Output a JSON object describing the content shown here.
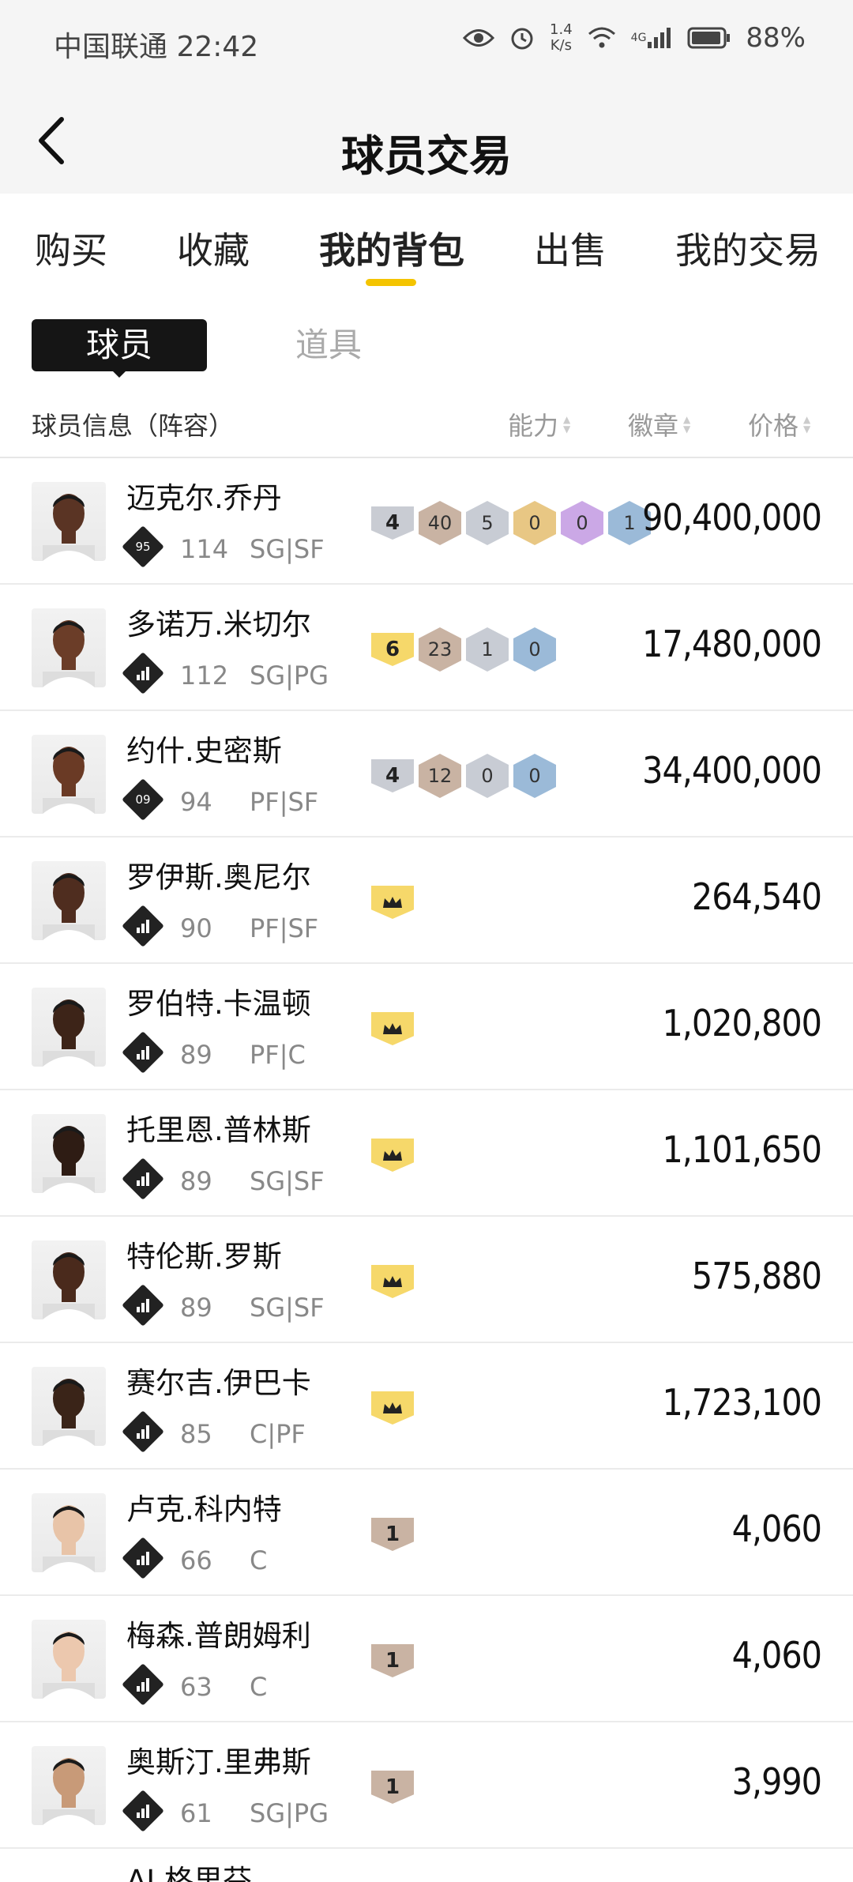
{
  "status_bar": {
    "carrier": "中国联通",
    "time": "22:42",
    "speed_value": "1.4",
    "speed_unit": "K/s",
    "network": "4G",
    "battery": "88%"
  },
  "header": {
    "title": "球员交易"
  },
  "tabs": [
    {
      "label": "购买"
    },
    {
      "label": "收藏"
    },
    {
      "label": "我的背包",
      "active": true
    },
    {
      "label": "出售"
    },
    {
      "label": "我的交易"
    }
  ],
  "subtabs": [
    {
      "label": "球员",
      "active": true
    },
    {
      "label": "道具"
    }
  ],
  "columns": {
    "info": "球员信息（阵容）",
    "ability": "能力",
    "badge": "徽章",
    "price": "价格"
  },
  "colors": {
    "accent": "#f4c400",
    "crown": "#f6d86a",
    "dark": "#151515"
  },
  "players": [
    {
      "name": "迈克尔.乔丹",
      "rating_icon": "95",
      "ovr": "114",
      "pos": "SG|SF",
      "badges": [
        {
          "kind": "shield",
          "value": "4",
          "color": "#c9ccd3"
        },
        {
          "kind": "hex",
          "value": "40",
          "color": "#c9b3a3"
        },
        {
          "kind": "hex",
          "value": "5",
          "color": "#c8ccd4"
        },
        {
          "kind": "hex",
          "value": "0",
          "color": "#e8c784"
        },
        {
          "kind": "hex",
          "value": "0",
          "color": "#cba8e6"
        },
        {
          "kind": "hex",
          "value": "1",
          "color": "#9bbad8"
        }
      ],
      "price": "90,400,000"
    },
    {
      "name": "多诺万.米切尔",
      "rating_icon": "bars",
      "ovr": "112",
      "pos": "SG|PG",
      "badges": [
        {
          "kind": "shield",
          "value": "6",
          "color": "#f6d86a"
        },
        {
          "kind": "hex",
          "value": "23",
          "color": "#c9b3a3"
        },
        {
          "kind": "hex",
          "value": "1",
          "color": "#c8ccd4"
        },
        {
          "kind": "hex",
          "value": "0",
          "color": "#9bbad8"
        }
      ],
      "price": "17,480,000"
    },
    {
      "name": "约什.史密斯",
      "rating_icon": "09",
      "ovr": "94",
      "pos": "PF|SF",
      "badges": [
        {
          "kind": "shield",
          "value": "4",
          "color": "#c9ccd3"
        },
        {
          "kind": "hex",
          "value": "12",
          "color": "#c9b3a3"
        },
        {
          "kind": "hex",
          "value": "0",
          "color": "#c8ccd4"
        },
        {
          "kind": "hex",
          "value": "0",
          "color": "#9bbad8"
        }
      ],
      "price": "34,400,000"
    },
    {
      "name": "罗伊斯.奥尼尔",
      "rating_icon": "bars",
      "ovr": "90",
      "pos": "PF|SF",
      "badges": [
        {
          "kind": "crown",
          "value": "",
          "color": "#f6d86a"
        }
      ],
      "price": "264,540"
    },
    {
      "name": "罗伯特.卡温顿",
      "rating_icon": "bars",
      "ovr": "89",
      "pos": "PF|C",
      "badges": [
        {
          "kind": "crown",
          "value": "",
          "color": "#f6d86a"
        }
      ],
      "price": "1,020,800"
    },
    {
      "name": "托里恩.普林斯",
      "rating_icon": "bars",
      "ovr": "89",
      "pos": "SG|SF",
      "badges": [
        {
          "kind": "crown",
          "value": "",
          "color": "#f6d86a"
        }
      ],
      "price": "1,101,650"
    },
    {
      "name": "特伦斯.罗斯",
      "rating_icon": "bars",
      "ovr": "89",
      "pos": "SG|SF",
      "badges": [
        {
          "kind": "crown",
          "value": "",
          "color": "#f6d86a"
        }
      ],
      "price": "575,880"
    },
    {
      "name": "赛尔吉.伊巴卡",
      "rating_icon": "bars",
      "ovr": "85",
      "pos": "C|PF",
      "badges": [
        {
          "kind": "crown",
          "value": "",
          "color": "#f6d86a"
        }
      ],
      "price": "1,723,100"
    },
    {
      "name": "卢克.科内特",
      "rating_icon": "bars",
      "ovr": "66",
      "pos": "C",
      "badges": [
        {
          "kind": "shield",
          "value": "1",
          "color": "#c9b3a3"
        }
      ],
      "price": "4,060"
    },
    {
      "name": "梅森.普朗姆利",
      "rating_icon": "bars",
      "ovr": "63",
      "pos": "C",
      "badges": [
        {
          "kind": "shield",
          "value": "1",
          "color": "#c9b3a3"
        }
      ],
      "price": "4,060"
    },
    {
      "name": "奥斯汀.里弗斯",
      "rating_icon": "bars",
      "ovr": "61",
      "pos": "SG|PG",
      "badges": [
        {
          "kind": "shield",
          "value": "1",
          "color": "#c9b3a3"
        }
      ],
      "price": "3,990"
    }
  ],
  "partial_row": {
    "name": "AJ.格里芬"
  }
}
